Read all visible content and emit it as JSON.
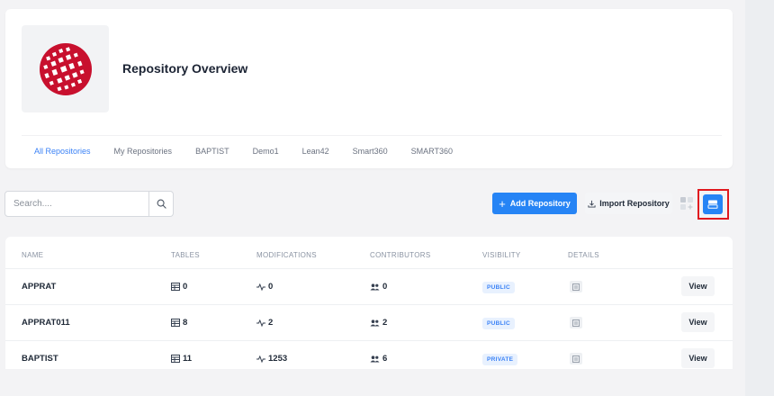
{
  "header": {
    "title": "Repository Overview",
    "tabs": [
      {
        "label": "All Repositories",
        "active": true
      },
      {
        "label": "My Repositories",
        "active": false
      },
      {
        "label": "BAPTIST",
        "active": false
      },
      {
        "label": "Demo1",
        "active": false
      },
      {
        "label": "Lean42",
        "active": false
      },
      {
        "label": "Smart360",
        "active": false
      },
      {
        "label": "SMART360",
        "active": false
      }
    ]
  },
  "toolbar": {
    "search_placeholder": "Search....",
    "add_label": "Add Repository",
    "import_label": "Import Repository",
    "view_mode": "list"
  },
  "table": {
    "headers": {
      "name": "NAME",
      "tables": "TABLES",
      "modifications": "MODIFICATIONS",
      "contributors": "CONTRIBUTORS",
      "visibility": "VISIBILITY",
      "details": "DETAILS"
    },
    "view_label": "View",
    "rows": [
      {
        "name": "APPRAT",
        "tables": "0",
        "modifications": "0",
        "contributors": "0",
        "visibility": "PUBLIC"
      },
      {
        "name": "APPRAT011",
        "tables": "8",
        "modifications": "2",
        "contributors": "2",
        "visibility": "PUBLIC"
      },
      {
        "name": "BAPTIST",
        "tables": "11",
        "modifications": "1253",
        "contributors": "6",
        "visibility": "PRIVATE"
      }
    ]
  },
  "colors": {
    "accent": "#2684f5",
    "logo": "#c8102e",
    "highlight": "#e0191f"
  }
}
